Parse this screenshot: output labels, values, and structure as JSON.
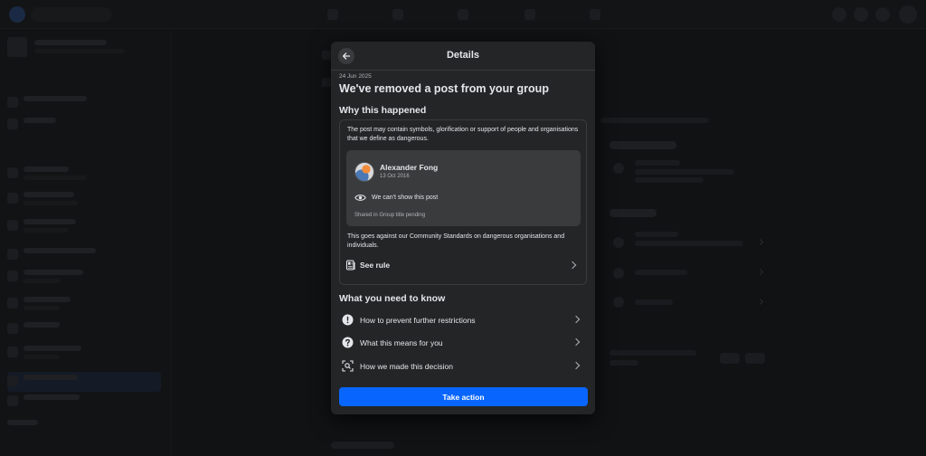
{
  "modal": {
    "title": "Details",
    "date": "24 Jun 2025",
    "headline": "We've removed a post from your group",
    "why_heading": "Why this happened",
    "why_text": "The post may contain symbols, glorification or support of people and organisations that we define as dangerous.",
    "post": {
      "author": "Alexander Fong",
      "date": "13 Oct 2016",
      "hidden_notice": "We can't show this post",
      "shared_in": "Shared in Group title pending"
    },
    "goes_against": "This goes against our Community Standards on dangerous organisations and individuals.",
    "see_rule": "See rule",
    "know_heading": "What you need to know",
    "know_items": [
      {
        "label": "How to prevent further restrictions",
        "icon": "exclamation-circle-icon"
      },
      {
        "label": "What this means for you",
        "icon": "question-circle-icon"
      },
      {
        "label": "How we made this decision",
        "icon": "scan-icon"
      }
    ],
    "take_action": "Take action"
  },
  "colors": {
    "accent": "#0866ff",
    "modal_bg": "#242526",
    "card_bg": "#3a3b3c",
    "text_primary": "#e4e6eb",
    "text_secondary": "#b0b3b8"
  }
}
